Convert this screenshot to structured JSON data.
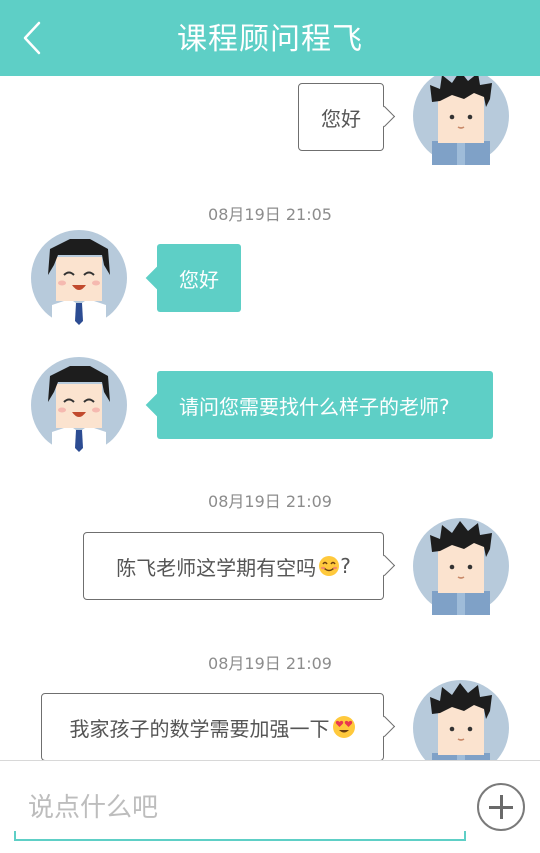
{
  "header": {
    "title": "课程顾问程飞",
    "back_icon": "chevron-left-icon"
  },
  "colors": {
    "accent": "#5ecfc6",
    "outgoing_border": "#6f6f6f",
    "timestamp": "#8c8c8c"
  },
  "messages": [
    {
      "sender": "user",
      "text": "您好"
    },
    {
      "timestamp": "08月19日 21:05"
    },
    {
      "sender": "advisor",
      "text": "您好"
    },
    {
      "sender": "advisor",
      "text": "请问您需要找什么样子的老师?"
    },
    {
      "timestamp": "08月19日 21:09"
    },
    {
      "sender": "user",
      "text": "陈飞老师这学期有空吗",
      "emoji": "smiling-face-emoji",
      "suffix": "?"
    },
    {
      "timestamp": "08月19日 21:09"
    },
    {
      "sender": "user",
      "text": "我家孩子的数学需要加强一下",
      "emoji": "heart-eyes-emoji"
    }
  ],
  "footer": {
    "input_placeholder": "说点什么吧",
    "input_value": "",
    "plus_icon": "plus-icon"
  }
}
